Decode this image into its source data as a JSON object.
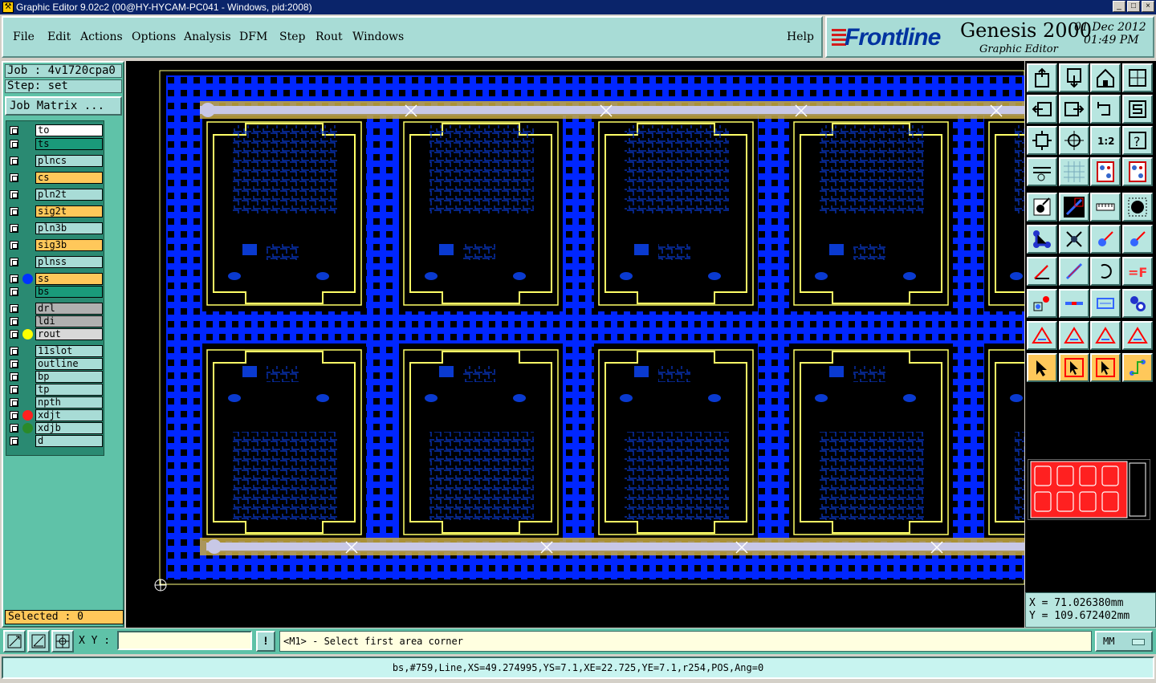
{
  "window": {
    "title": "Graphic Editor 9.02c2 (00@HY-HYCAM-PC041 - Windows, pid:2008)",
    "buttons": [
      "minimize",
      "maximize",
      "close"
    ]
  },
  "menu": {
    "items": [
      "File",
      "Edit",
      "Actions",
      "Options",
      "Analysis",
      "DFM",
      "Step",
      "Rout",
      "Windows"
    ],
    "help": "Help"
  },
  "brand": {
    "logo": "Frontline",
    "product": "Genesis 2000",
    "subtitle": "Graphic Editor",
    "date": "01 Dec 2012",
    "time": "01:49 PM"
  },
  "job": {
    "job_label": "Job : 4v1720cpa0",
    "step_label": "Step: set",
    "matrix_button": "Job Matrix ..."
  },
  "layers": [
    {
      "name": "to",
      "color": "#ffffff",
      "dot": ""
    },
    {
      "name": "ts",
      "color": "#1a9a7a",
      "dot": ""
    },
    {
      "name": "plncs",
      "color": "#a8dcd6",
      "dot": ""
    },
    {
      "name": "cs",
      "color": "#ffc85a",
      "dot": ""
    },
    {
      "name": "pln2t",
      "color": "#a8dcd6",
      "dot": ""
    },
    {
      "name": "sig2t",
      "color": "#ffc85a",
      "dot": ""
    },
    {
      "name": "pln3b",
      "color": "#a8dcd6",
      "dot": ""
    },
    {
      "name": "sig3b",
      "color": "#ffc85a",
      "dot": ""
    },
    {
      "name": "plnss",
      "color": "#a8dcd6",
      "dot": ""
    },
    {
      "name": "ss",
      "color": "#ffc85a",
      "dot": "#0033ff"
    },
    {
      "name": "bs",
      "color": "#1a9a7a",
      "dot": ""
    },
    {
      "name": "drl",
      "color": "#b0b0b0",
      "dot": ""
    },
    {
      "name": "ldi",
      "color": "#b0b0b0",
      "dot": ""
    },
    {
      "name": "rout",
      "color": "#d8d8d8",
      "dot": "#ffff00"
    },
    {
      "name": "11slot",
      "color": "#a8dcd6",
      "dot": ""
    },
    {
      "name": "outline",
      "color": "#a8dcd6",
      "dot": ""
    },
    {
      "name": "bp",
      "color": "#a8dcd6",
      "dot": ""
    },
    {
      "name": "tp",
      "color": "#a8dcd6",
      "dot": ""
    },
    {
      "name": "npth",
      "color": "#a8dcd6",
      "dot": ""
    },
    {
      "name": "xdjt",
      "color": "#a8dcd6",
      "dot": "#ff2020"
    },
    {
      "name": "xdjb",
      "color": "#a8dcd6",
      "dot": "#2a8a2a"
    },
    {
      "name": "d",
      "color": "#a8dcd6",
      "dot": ""
    }
  ],
  "selected": "Selected : 0",
  "toolbar": {
    "tools": [
      "move-up-icon",
      "move-down-icon",
      "home-icon",
      "zoom-window-icon",
      "move-left-icon",
      "move-right-icon",
      "reverse-icon",
      "snap-icon",
      "fit-icon",
      "center-icon",
      "ratio-icon",
      "help-icon",
      "measure-icon",
      "grid-icon",
      "layer-mode-icon",
      "layer-mode-alt-icon",
      "feature-icon",
      "line-icon",
      "ruler-icon",
      "pad-icon",
      "connect-icon",
      "cross-icon",
      "arrow-pad-icon",
      "arrow-pad-alt-icon",
      "angle-icon",
      "slash-icon",
      "arc-icon",
      "fit-text-icon",
      "point-icon",
      "dash-icon",
      "measure-box-icon",
      "pad-group-icon",
      "triangle-icon",
      "triangle-alt-icon",
      "triangle-b-icon",
      "triangle-c-icon",
      "select-icon",
      "select-box-icon",
      "select-alt-icon",
      "select-net-icon"
    ],
    "ratio_label": "1:2",
    "active": [
      "select-icon",
      "select-box-icon",
      "select-alt-icon",
      "select-net-icon"
    ]
  },
  "coords": {
    "x": "X  =  71.026380mm",
    "y": "Y  = 109.672402mm"
  },
  "status": {
    "xy_label": "X Y :",
    "xy_value": "",
    "excl": "!",
    "prompt": "<M1> - Select first area corner",
    "units": "MM"
  },
  "info": "bs,#759,Line,XS=49.274995,YS=7.1,XE=22.725,YE=7.1,r254,POS,Ang=0"
}
